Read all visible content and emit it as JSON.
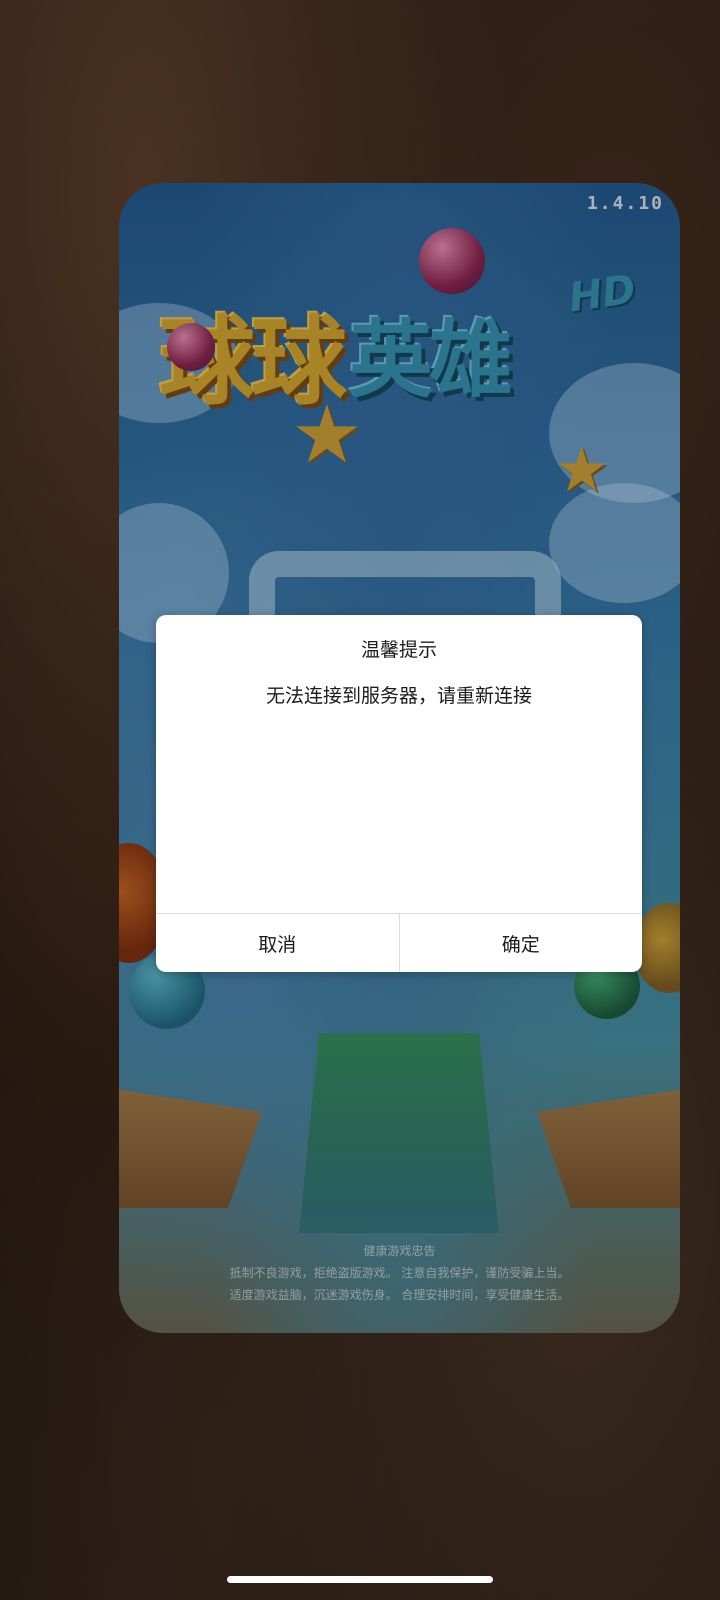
{
  "game": {
    "version": "1.4.10",
    "title_part1": "球球",
    "title_part2": "英雄",
    "title_hd": "HD",
    "notice": {
      "title": "健康游戏忠告",
      "line1": "抵制不良游戏，拒绝盗版游戏。 注意自我保护，谨防受骗上当。",
      "line2": "适度游戏益脑，沉迷游戏伤身。 合理安排时间，享受健康生活。"
    }
  },
  "dialog": {
    "title": "温馨提示",
    "message": "无法连接到服务器，请重新连接",
    "cancel_label": "取消",
    "confirm_label": "确定"
  }
}
